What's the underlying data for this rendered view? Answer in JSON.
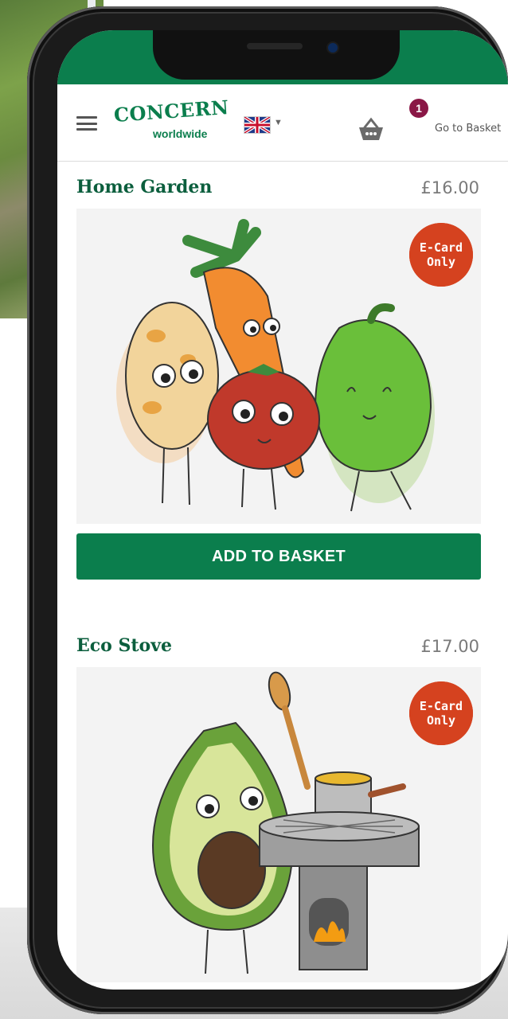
{
  "header": {
    "brand_main": "CONCERN",
    "brand_sub": "worldwide",
    "basket_count": "1",
    "go_to_basket": "Go to Basket",
    "language_flag": "uk-flag-icon"
  },
  "products": [
    {
      "title": "Home Garden",
      "price": "£16.00",
      "badge_line1": "E-Card",
      "badge_line2": "Only",
      "button": "ADD TO BASKET"
    },
    {
      "title": "Eco Stove",
      "price": "£17.00",
      "badge_line1": "E-Card",
      "badge_line2": "Only"
    }
  ],
  "colors": {
    "brand_green": "#0b7e4d",
    "badge_red": "#d5421f",
    "basket_badge": "#8a1746"
  }
}
